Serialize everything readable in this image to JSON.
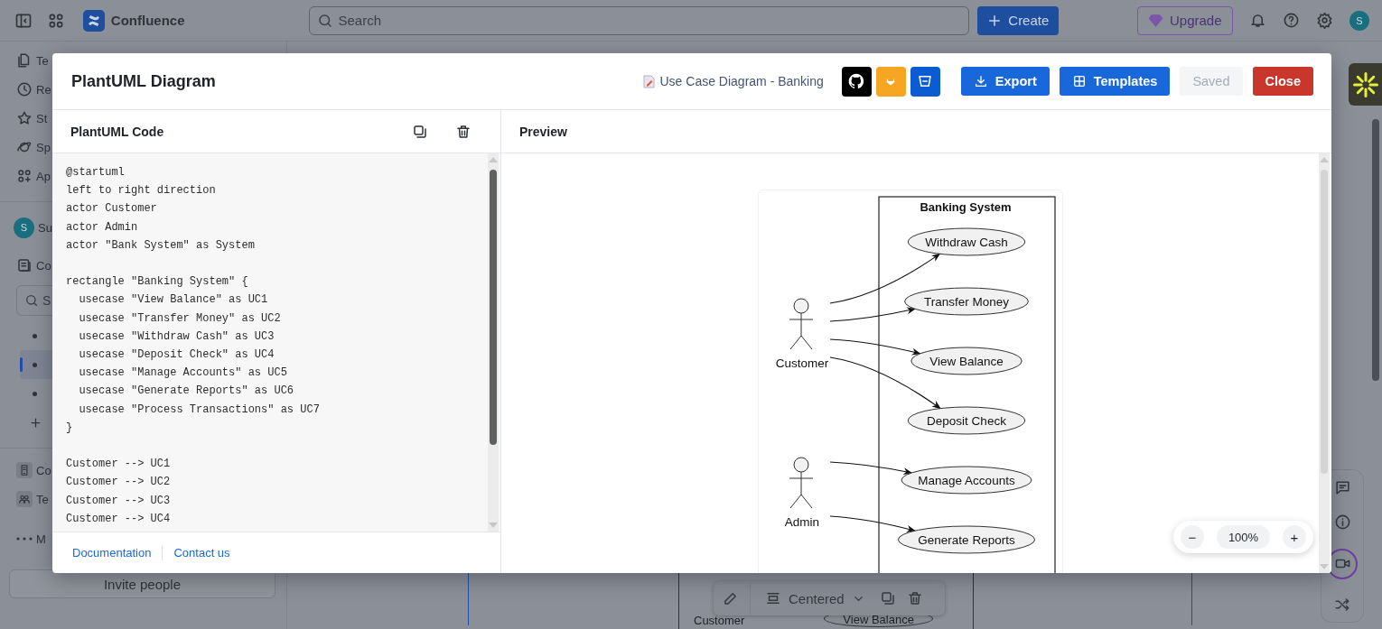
{
  "top_bar": {
    "product_name": "Confluence",
    "search": {
      "placeholder": "Search"
    },
    "create_button": "Create",
    "upgrade_button": "Upgrade",
    "avatar_initial": "S"
  },
  "sidebar": {
    "items": [
      {
        "label": "Te"
      },
      {
        "label": "Re"
      },
      {
        "label": "St"
      },
      {
        "label": "Sp"
      },
      {
        "label": "Ap"
      }
    ],
    "space": {
      "avatar_initial": "S",
      "label": "Su"
    },
    "content_label": "Co",
    "search": {
      "placeholder": "S"
    },
    "tree_items": [
      {
        "selected": false
      },
      {
        "selected": true
      },
      {
        "selected": false
      }
    ],
    "bottom_items": [
      {
        "label": "Co"
      },
      {
        "label": "Te"
      }
    ],
    "more_label": "M",
    "invite_button": "Invite people"
  },
  "page": {
    "diagram_labels": [
      "Customer",
      "View Balance"
    ],
    "floating_toolbar": {
      "alignment_label": "Centered"
    }
  },
  "modal": {
    "title": "PlantUML Diagram",
    "document_name": "Use Case Diagram - Banking",
    "integrations": [
      {
        "kind": "github"
      },
      {
        "kind": "gitlab"
      },
      {
        "kind": "bitbucket"
      }
    ],
    "buttons": [
      {
        "kind": "export",
        "label": "Export",
        "disabled": false
      },
      {
        "kind": "templates",
        "label": "Templates",
        "disabled": false
      },
      {
        "kind": "saved",
        "label": "Saved",
        "disabled": true
      },
      {
        "kind": "close",
        "label": "Close",
        "disabled": false
      }
    ],
    "code_panel": {
      "title": "PlantUML Code",
      "code": "@startuml\nleft to right direction\nactor Customer\nactor Admin\nactor \"Bank System\" as System\n\nrectangle \"Banking System\" {\n  usecase \"View Balance\" as UC1\n  usecase \"Transfer Money\" as UC2\n  usecase \"Withdraw Cash\" as UC3\n  usecase \"Deposit Check\" as UC4\n  usecase \"Manage Accounts\" as UC5\n  usecase \"Generate Reports\" as UC6\n  usecase \"Process Transactions\" as UC7\n}\n\nCustomer --> UC1\nCustomer --> UC2\nCustomer --> UC3\nCustomer --> UC4",
      "links": [
        "Documentation",
        "Contact us"
      ]
    },
    "preview_panel": {
      "title": "Preview",
      "diagram": {
        "system_title": "Banking System",
        "actors": [
          {
            "name": "Customer",
            "use_cases": [
              "Withdraw Cash",
              "Transfer Money",
              "View Balance",
              "Deposit Check"
            ]
          },
          {
            "name": "Admin",
            "use_cases": [
              "Manage Accounts",
              "Generate Reports"
            ]
          }
        ]
      },
      "zoom": {
        "minus": "−",
        "level_text": "100%",
        "plus": "+"
      }
    }
  }
}
